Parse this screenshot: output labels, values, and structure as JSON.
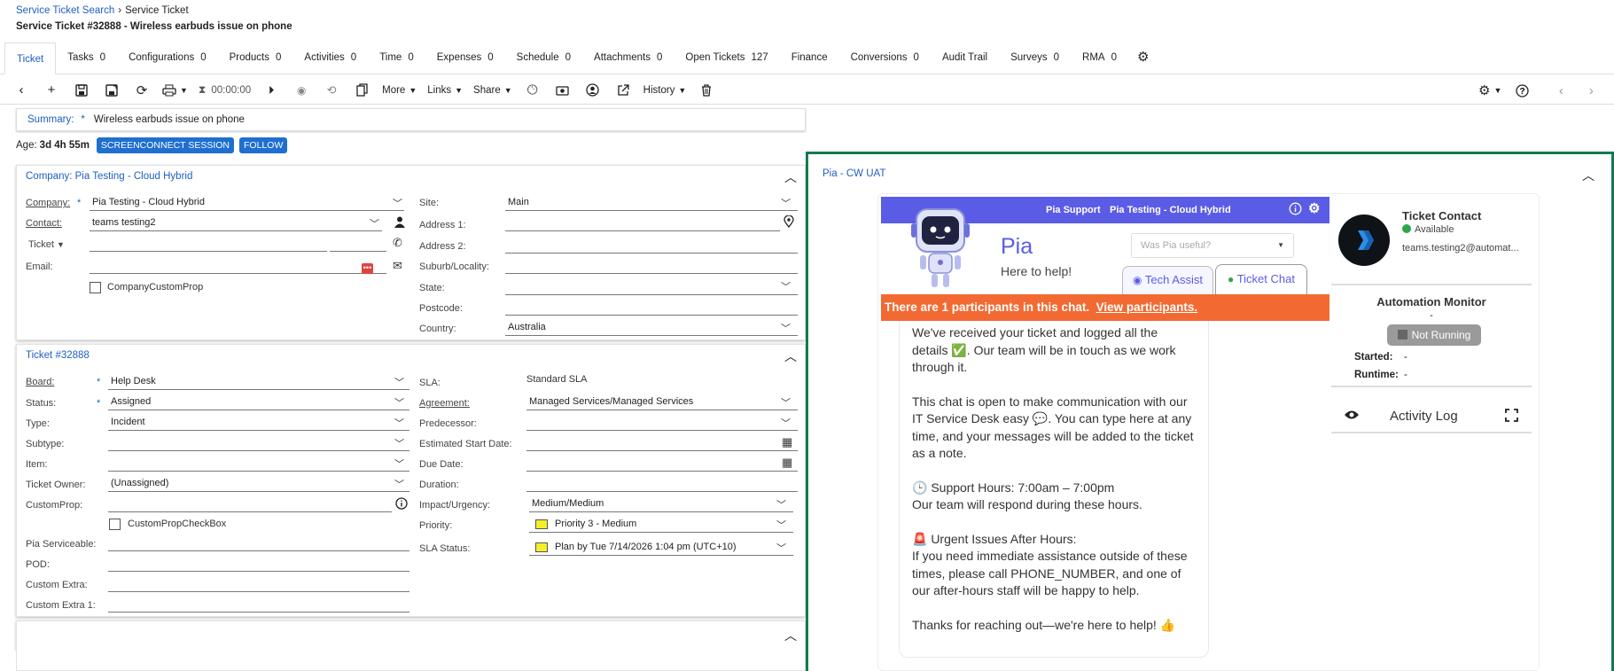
{
  "breadcrumb": {
    "parent": "Service Ticket Search",
    "current": "Service Ticket"
  },
  "title": "Service Ticket #32888 - Wireless earbuds issue on phone",
  "tabs": [
    {
      "label": "Ticket",
      "count": ""
    },
    {
      "label": "Tasks",
      "count": "0"
    },
    {
      "label": "Configurations",
      "count": "0"
    },
    {
      "label": "Products",
      "count": "0"
    },
    {
      "label": "Activities",
      "count": "0"
    },
    {
      "label": "Time",
      "count": "0"
    },
    {
      "label": "Expenses",
      "count": "0"
    },
    {
      "label": "Schedule",
      "count": "0"
    },
    {
      "label": "Attachments",
      "count": "0"
    },
    {
      "label": "Open Tickets",
      "count": "127"
    },
    {
      "label": "Finance",
      "count": ""
    },
    {
      "label": "Conversions",
      "count": "0"
    },
    {
      "label": "Audit Trail",
      "count": ""
    },
    {
      "label": "Surveys",
      "count": "0"
    },
    {
      "label": "RMA",
      "count": "0"
    }
  ],
  "toolbar": {
    "timer": "00:00:00",
    "more": "More",
    "links": "Links",
    "share": "Share",
    "history": "History"
  },
  "summary": {
    "label": "Summary:",
    "req": "*",
    "value": "Wireless earbuds issue on phone"
  },
  "age": {
    "label": "Age:",
    "value": "3d 4h 55m",
    "screenconnect": "SCREENCONNECT SESSION",
    "follow": "FOLLOW"
  },
  "company_panel": {
    "title": "Company: Pia Testing - Cloud Hybrid",
    "company_label": "Company:",
    "company_value": "Pia Testing - Cloud Hybrid",
    "contact_label": "Contact:",
    "contact_value": "teams testing2",
    "ticket_dd": "Ticket",
    "email_label": "Email:",
    "custom_prop": "CompanyCustomProp",
    "site_label": "Site:",
    "site_value": "Main",
    "addr1": "Address 1:",
    "addr2": "Address 2:",
    "suburb": "Suburb/Locality:",
    "state": "State:",
    "postcode": "Postcode:",
    "country_label": "Country:",
    "country_value": "Australia"
  },
  "ticket_panel": {
    "title": "Ticket #32888",
    "board_label": "Board:",
    "board_value": "Help Desk",
    "status_label": "Status:",
    "status_value": "Assigned",
    "type_label": "Type:",
    "type_value": "Incident",
    "subtype_label": "Subtype:",
    "item_label": "Item:",
    "owner_label": "Ticket Owner:",
    "owner_value": "(Unassigned)",
    "customprop_label": "CustomProp:",
    "checkbox_label": "CustomPropCheckBox",
    "pia_label": "Pia Serviceable:",
    "pod_label": "POD:",
    "extra_label": "Custom Extra:",
    "extra1_label": "Custom Extra 1:",
    "sla_label": "SLA:",
    "sla_value": "Standard SLA",
    "agreement_label": "Agreement:",
    "agreement_value": "Managed Services/Managed Services",
    "pred_label": "Predecessor:",
    "est_label": "Estimated Start Date:",
    "due_label": "Due Date:",
    "dur_label": "Duration:",
    "impact_label": "Impact/Urgency:",
    "impact_value": "Medium/Medium",
    "priority_label": "Priority:",
    "priority_value": "Priority 3 - Medium",
    "slastatus_label": "SLA Status:",
    "slastatus_value": "Plan by Tue 7/14/2026 1:04 pm (UTC+10)"
  },
  "pia": {
    "header": "Pia - CW UAT",
    "support": "Pia Support",
    "company": "Pia Testing - Cloud Hybrid",
    "name": "Pia",
    "tagline": "Here to help!",
    "useful_placeholder": "Was Pia useful?",
    "tech_assist": "Tech Assist",
    "ticket_chat": "Ticket Chat",
    "banner_text": "There are 1 participants in this chat.",
    "banner_link": "View participants.",
    "msg1": "We've received your ticket and logged all the details ✅. Our team will be in touch as we work through it.",
    "msg2": "This chat is open to make communication with our IT Service Desk easy 💬. You can type here at any time, and your messages will be added to the ticket as a note.",
    "msg3a": "🕒 Support Hours: 7:00am – 7:00pm",
    "msg3b": "Our team will respond during these hours.",
    "msg4a": "🚨 Urgent Issues After Hours:",
    "msg4b": "If you need immediate assistance outside of these times, please call PHONE_NUMBER, and one of our after-hours staff will be happy to help.",
    "msg5": "Thanks for reaching out—we're here to help! 👍",
    "contact_title": "Ticket Contact",
    "contact_status": "Available",
    "contact_email": "teams.testing2@automat...",
    "monitor_title": "Automation Monitor",
    "monitor_dash": "-",
    "monitor_status": "Not Running",
    "started_label": "Started:",
    "started_value": "-",
    "runtime_label": "Runtime:",
    "runtime_value": "-",
    "activity_log": "Activity Log"
  },
  "colors": {
    "link": "#1f5fbf",
    "button": "#1f6fd1",
    "pia_header": "#5a5ce6",
    "banner": "#f26a32",
    "frame": "#137a4f",
    "available": "#2ca84a"
  }
}
